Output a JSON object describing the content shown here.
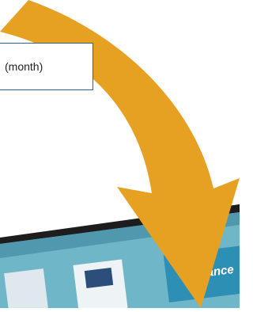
{
  "label": {
    "text": "(month)"
  },
  "colors": {
    "arrow": "#E6A123",
    "box_border": "#2F5F9F",
    "screen_bg": "#6FB6C9",
    "monitor_frame": "#1d1d1d"
  },
  "monitor": {
    "brand_text": "liance"
  },
  "icons": [
    "curved-arrow-icon"
  ]
}
